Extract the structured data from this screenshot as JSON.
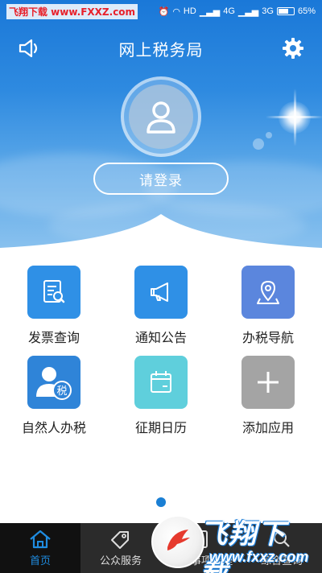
{
  "status_bar": {
    "watermark": "飞翔下载 www.FXXZ.com",
    "network_hd": "HD",
    "network_4g": "4G",
    "network_3g": "3G",
    "battery_text": "65%",
    "battery_level": 0.65
  },
  "header": {
    "title": "网上税务局",
    "speaker_icon": "speaker-icon",
    "settings_icon": "gear-icon"
  },
  "login": {
    "button_label": "请登录",
    "avatar_icon": "user-icon"
  },
  "apps": [
    {
      "label": "发票查询",
      "icon": "invoice-search-icon",
      "color": "#2f90e6"
    },
    {
      "label": "通知公告",
      "icon": "megaphone-icon",
      "color": "#2f90e6"
    },
    {
      "label": "办税导航",
      "icon": "map-pin-icon",
      "color": "#5b86dd"
    },
    {
      "label": "自然人办税",
      "icon": "person-tax-icon",
      "color": "#2f84d8"
    },
    {
      "label": "征期日历",
      "icon": "calendar-icon",
      "color": "#5fcfdc"
    },
    {
      "label": "添加应用",
      "icon": "plus-icon",
      "color": "#a4a4a4"
    }
  ],
  "bottom_nav": [
    {
      "label": "首页",
      "icon": "home-icon",
      "active": true
    },
    {
      "label": "公众服务",
      "icon": "tag-icon",
      "active": false
    },
    {
      "label": "涉税事项办理",
      "icon": "document-icon",
      "active": false
    },
    {
      "label": "综合查询",
      "icon": "search-icon",
      "active": false
    }
  ],
  "overlay_watermark": {
    "title": "飞翔下载",
    "url": "www.fxxz.com"
  },
  "colors": {
    "accent": "#1f8ce0",
    "nav_bg": "#2b2b2b"
  }
}
